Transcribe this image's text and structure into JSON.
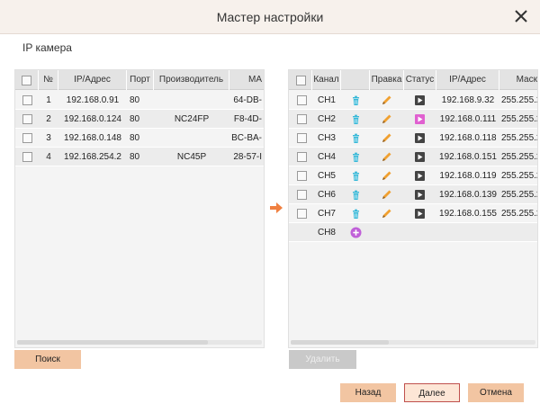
{
  "dialog": {
    "title": "Мастер настройки"
  },
  "section_title": "IP камера",
  "left_table": {
    "headers": [
      "№",
      "IP/Адрес",
      "Порт",
      "Производитель",
      "MA"
    ],
    "rows": [
      {
        "no": "1",
        "ip": "192.168.0.91",
        "port": "80",
        "vendor": "",
        "mac": "64-DB-"
      },
      {
        "no": "2",
        "ip": "192.168.0.124",
        "port": "80",
        "vendor": "NC24FP",
        "mac": "F8-4D-"
      },
      {
        "no": "3",
        "ip": "192.168.0.148",
        "port": "80",
        "vendor": "",
        "mac": "BC-BA-"
      },
      {
        "no": "4",
        "ip": "192.168.254.2",
        "port": "80",
        "vendor": "NC45P",
        "mac": "28-57-I"
      }
    ]
  },
  "right_table": {
    "headers": [
      "Канал",
      "Правка",
      "Статус",
      "IP/Адрес",
      "Маск"
    ],
    "rows": [
      {
        "channel": "CH1",
        "status": "play",
        "ip": "192.168.9.32",
        "mask": "255.255.2"
      },
      {
        "channel": "CH2",
        "status": "play-pink",
        "ip": "192.168.0.111",
        "mask": "255.255.2"
      },
      {
        "channel": "CH3",
        "status": "play",
        "ip": "192.168.0.118",
        "mask": "255.255.2"
      },
      {
        "channel": "CH4",
        "status": "play",
        "ip": "192.168.0.151",
        "mask": "255.255.2"
      },
      {
        "channel": "CH5",
        "status": "play",
        "ip": "192.168.0.119",
        "mask": "255.255.2"
      },
      {
        "channel": "CH6",
        "status": "play",
        "ip": "192.168.0.139",
        "mask": "255.255.2"
      },
      {
        "channel": "CH7",
        "status": "play",
        "ip": "192.168.0.155",
        "mask": "255.255.2"
      }
    ],
    "empty_channel": "CH8"
  },
  "buttons": {
    "search": "Поиск",
    "delete": "Удалить",
    "back": "Назад",
    "next": "Далее",
    "cancel": "Отмена"
  },
  "colors": {
    "accent": "#f2c5a2",
    "trash": "#36b8d8",
    "pencil": "#f0a030",
    "add": "#c060d8",
    "status_dark": "#444444",
    "status_pink": "#e060d0",
    "arrow": "#f08040"
  }
}
